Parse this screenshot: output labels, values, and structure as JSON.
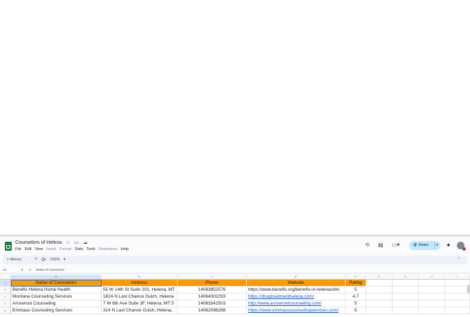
{
  "doc": {
    "title": "Counselors of Helena"
  },
  "menu": [
    "File",
    "Edit",
    "View",
    "Insert",
    "Format",
    "Data",
    "Tools",
    "Extensions",
    "Help"
  ],
  "menu_dim": [
    false,
    false,
    false,
    true,
    true,
    false,
    false,
    true,
    false
  ],
  "toolbar": {
    "menus_label": "Menus",
    "zoom": "100%"
  },
  "share": {
    "label": "Share"
  },
  "formula_bar": {
    "cell_ref": "A1",
    "value": "Name of Counselors"
  },
  "columns": [
    "",
    "A",
    "B",
    "C",
    "D",
    "E",
    "F",
    "G",
    "H",
    "I"
  ],
  "row_numbers": [
    "1",
    "2",
    "3",
    "4",
    "5"
  ],
  "table": {
    "headers": [
      "Name of Counselors",
      "Address",
      "Phone",
      "Website",
      "Rating"
    ],
    "rows": [
      [
        "Benefis Helena Home Health",
        "55 W 14th St Suite 201, Helena, MT",
        "14063852576",
        "https://www.benefis.org/benefis-in-helena/clini",
        "5"
      ],
      [
        "Montana Counseling Services",
        "1824 N Last Chance Gulch, Helena",
        "14064302293",
        "https://drugtreatmenthelena.com/",
        "4.7"
      ],
      [
        "Arrowroot Counseling",
        "7 W 6th Ave Suite 3F, Helena, MT 5",
        "14063342503",
        "http://www.arrowrootcounseling.com/",
        "5"
      ],
      [
        "Emmaus Counseling Services",
        "314 N Last Chance Gulch, Helena,",
        "14062098268",
        "https://www.emmauscounselingservices.com/",
        "5"
      ]
    ]
  },
  "icons": {
    "history": "history-icon",
    "comments": "comment-icon",
    "meet": "video-call-icon",
    "gemini": "gemini-sparkle-icon"
  },
  "colors": {
    "header_fill": "#ff9900",
    "link": "#1155cc",
    "selection": "#1a73e8",
    "share_bg": "#c2e7ff"
  }
}
